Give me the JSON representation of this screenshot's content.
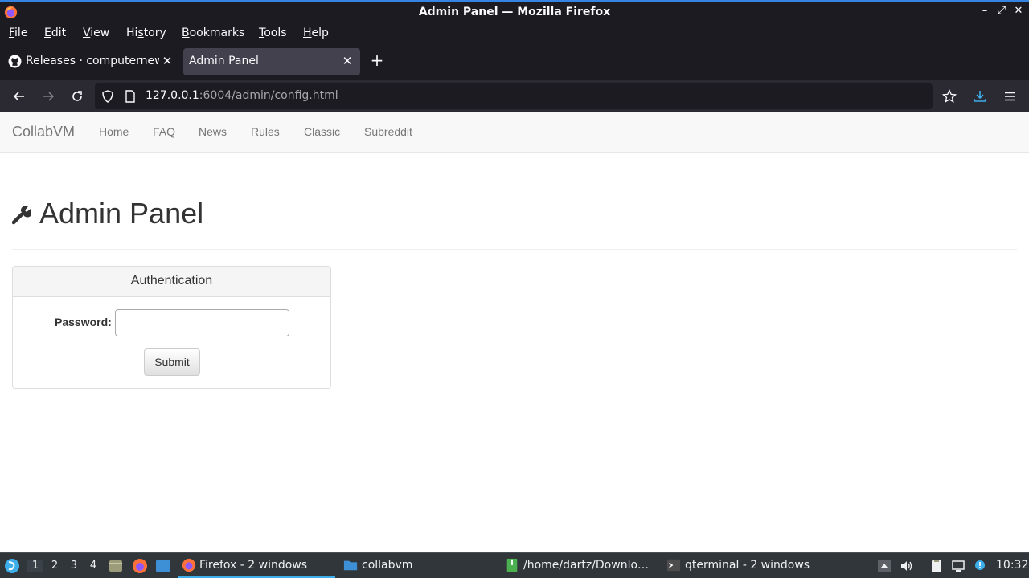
{
  "window": {
    "title": "Admin Panel — Mozilla Firefox",
    "controls": {
      "minimize": "–",
      "maximize": "⤢",
      "close": "✕"
    }
  },
  "menubar": {
    "items": [
      {
        "label": "File",
        "accel": "F",
        "rest": "ile"
      },
      {
        "label": "Edit",
        "accel": "E",
        "rest": "dit"
      },
      {
        "label": "View",
        "accel": "V",
        "rest": "iew"
      },
      {
        "label": "History",
        "pre": "Hi",
        "accel": "s",
        "rest": "tory"
      },
      {
        "label": "Bookmarks",
        "accel": "B",
        "rest": "ookmarks"
      },
      {
        "label": "Tools",
        "accel": "T",
        "rest": "ools"
      },
      {
        "label": "Help",
        "accel": "H",
        "rest": "elp"
      }
    ]
  },
  "tabs": [
    {
      "label": "Releases · computernewb/collab-vm",
      "icon": "github-icon",
      "active": false
    },
    {
      "label": "Admin Panel",
      "active": true
    }
  ],
  "newtab_label": "+",
  "nav": {
    "url_host": "127.0.0.1",
    "url_rest": ":6004/admin/config.html"
  },
  "site": {
    "brand": "CollabVM",
    "links": [
      "Home",
      "FAQ",
      "News",
      "Rules",
      "Classic",
      "Subreddit"
    ]
  },
  "page": {
    "heading": "Admin Panel",
    "panel_title": "Authentication",
    "password_label": "Password:",
    "password_value": "",
    "submit_label": "Submit"
  },
  "taskbar": {
    "workspaces": [
      "1",
      "2",
      "3",
      "4"
    ],
    "active_workspace": "1",
    "tasks": [
      {
        "label": "Firefox - 2 windows",
        "icon": "firefox-icon",
        "active": true
      },
      {
        "label": "collabvm",
        "icon": "folder-icon",
        "active": false
      },
      {
        "label": "/home/dartz/Downlo…",
        "icon": "archive-icon",
        "active": false
      },
      {
        "label": "qterminal - 2 windows",
        "icon": "terminal-icon",
        "active": false
      }
    ],
    "clock": "10:32"
  },
  "colors": {
    "browser_chrome": "#1c1b22",
    "toolbar": "#2b2a33",
    "taskbar": "#31363b",
    "accent": "#3daee9"
  }
}
